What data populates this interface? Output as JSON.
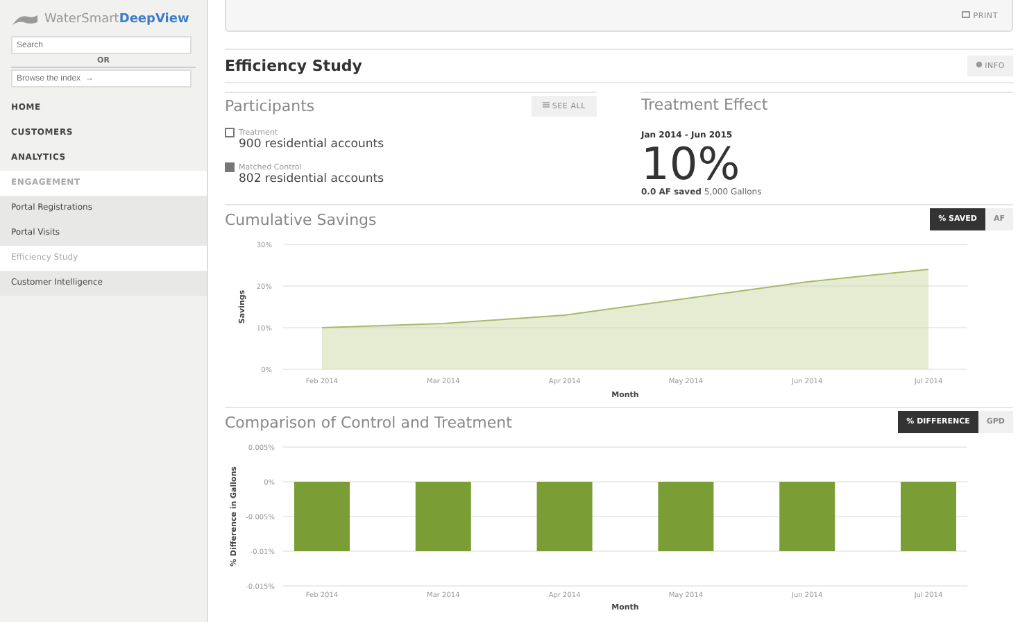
{
  "sidebar": {
    "logo": {
      "brand": "WaterSmart",
      "product": "DeepView"
    },
    "search": {
      "placeholder": "Search"
    },
    "or": "OR",
    "browse": {
      "placeholder": "Browse the index  →"
    },
    "items": [
      {
        "label": "HOME",
        "kind": "section",
        "selected": false
      },
      {
        "label": "CUSTOMERS",
        "kind": "section",
        "selected": false
      },
      {
        "label": "ANALYTICS",
        "kind": "section",
        "selected": false
      },
      {
        "label": "ENGAGEMENT",
        "kind": "section",
        "selected": true
      },
      {
        "label": "Portal Registrations",
        "kind": "page",
        "selected": false
      },
      {
        "label": "Portal Visits",
        "kind": "page",
        "selected": false
      },
      {
        "label": "Efficiency Study",
        "kind": "page",
        "selected": true
      },
      {
        "label": "Customer Intelligence",
        "kind": "page",
        "selected": false
      }
    ]
  },
  "toolbar": {
    "print": "PRINT"
  },
  "header": {
    "title": "Efficiency Study",
    "info": "INFO"
  },
  "participants": {
    "title": "Participants",
    "see_all": "SEE ALL",
    "groups": [
      {
        "label": "Treatment",
        "value": "900 residential accounts"
      },
      {
        "label": "Matched Control",
        "value": "802 residential accounts"
      }
    ]
  },
  "treatment_effect": {
    "title": "Treatment Effect",
    "period": "Jan 2014 - Jun 2015",
    "percent": "10%",
    "saved_bold": "0.0 AF saved",
    "saved_rest": "5,000 Gallons"
  },
  "cumulative_savings": {
    "title": "Cumulative Savings",
    "toggles": [
      {
        "label": "% SAVED",
        "selected": true
      },
      {
        "label": "AF",
        "selected": false
      }
    ],
    "chart_data": {
      "type": "area",
      "xlabel": "Month",
      "ylabel": "Savings",
      "categories": [
        "Feb 2014",
        "Mar 2014",
        "Apr 2014",
        "May 2014",
        "Jun 2014",
        "Jul 2014"
      ],
      "series": [
        {
          "color": "#c8d49a",
          "values": [
            10,
            11,
            13,
            17,
            21,
            24
          ]
        }
      ],
      "grid": true,
      "ylim": [
        0,
        30
      ],
      "yticks": [
        {
          "value": 0,
          "label": "0%"
        },
        {
          "value": 10,
          "label": "10%"
        },
        {
          "value": 20,
          "label": "20%"
        },
        {
          "value": 30,
          "label": "30%"
        }
      ]
    }
  },
  "comparison": {
    "title": "Comparison of Control and Treatment",
    "toggles": [
      {
        "label": "% DIFFERENCE",
        "selected": true
      },
      {
        "label": "GPD",
        "selected": false
      }
    ],
    "chart_data": {
      "type": "bar",
      "xlabel": "Month",
      "ylabel": "% Difference in Gallons",
      "categories": [
        "Feb 2014",
        "Mar 2014",
        "Apr 2014",
        "May 2014",
        "Jun 2014",
        "Jul 2014"
      ],
      "series": [
        {
          "color": "#7a9e35",
          "values": [
            -0.01,
            -0.01,
            -0.01,
            -0.01,
            -0.01,
            -0.01
          ]
        }
      ],
      "grid": true,
      "ylim": [
        -0.015,
        0.005
      ],
      "yticks": [
        {
          "value": 0.005,
          "label": "0.005%"
        },
        {
          "value": 0,
          "label": "0%"
        },
        {
          "value": -0.005,
          "label": "-0.005%"
        },
        {
          "value": -0.01,
          "label": "-0.01%"
        },
        {
          "value": -0.015,
          "label": "-0.015%"
        }
      ]
    }
  }
}
